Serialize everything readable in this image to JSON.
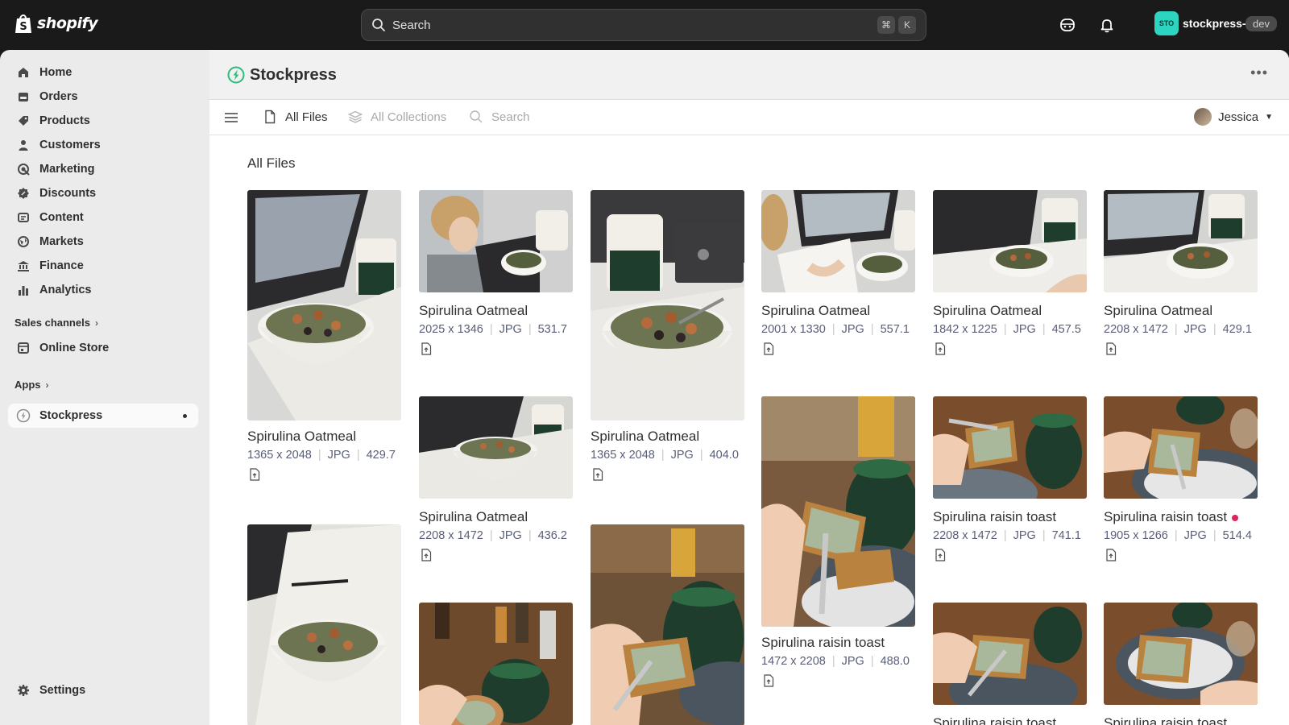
{
  "topbar": {
    "brand": "shopify",
    "search_placeholder": "Search",
    "shortcut_keys": [
      "⌘",
      "K"
    ],
    "store_initials": "STO",
    "store_name": "stockpress-",
    "env_badge": "dev"
  },
  "sidebar": {
    "items": [
      {
        "label": "Home",
        "icon": "home-icon"
      },
      {
        "label": "Orders",
        "icon": "orders-icon"
      },
      {
        "label": "Products",
        "icon": "tag-icon"
      },
      {
        "label": "Customers",
        "icon": "person-icon"
      },
      {
        "label": "Marketing",
        "icon": "target-icon"
      },
      {
        "label": "Discounts",
        "icon": "discount-icon"
      },
      {
        "label": "Content",
        "icon": "content-icon"
      },
      {
        "label": "Markets",
        "icon": "globe-icon"
      },
      {
        "label": "Finance",
        "icon": "bank-icon"
      },
      {
        "label": "Analytics",
        "icon": "bar-chart-icon"
      }
    ],
    "sales_channels_heading": "Sales channels",
    "online_store_label": "Online Store",
    "apps_heading": "Apps",
    "app_item_label": "Stockpress",
    "settings_label": "Settings"
  },
  "app": {
    "title": "Stockpress",
    "more_label": "•••",
    "toolbar": {
      "all_files": "All Files",
      "all_collections": "All Collections",
      "search": "Search",
      "user_name": "Jessica"
    },
    "page_heading": "All Files"
  },
  "files": [
    {
      "title": "Spirulina Oatmeal",
      "dims": "1365 x 2048",
      "type": "JPG",
      "size": "429.7"
    },
    {
      "title": "Spirulina Oatmeal",
      "dims": "2025 x 1346",
      "type": "JPG",
      "size": "531.7"
    },
    {
      "title": "Spirulina Oatmeal",
      "dims": "1365 x 2048",
      "type": "JPG",
      "size": "404.0"
    },
    {
      "title": "Spirulina Oatmeal",
      "dims": "2001 x 1330",
      "type": "JPG",
      "size": "557.1"
    },
    {
      "title": "Spirulina Oatmeal",
      "dims": "1842 x 1225",
      "type": "JPG",
      "size": "457.5"
    },
    {
      "title": "Spirulina Oatmeal",
      "dims": "2208 x 1472",
      "type": "JPG",
      "size": "429.1"
    },
    {
      "title": "Spirulina Oatmeal",
      "dims": "2208 x 1472",
      "type": "JPG",
      "size": "436.2"
    },
    {
      "title": "Spirulina raisin toast",
      "dims": "1472 x 2208",
      "type": "JPG",
      "size": "488.0"
    },
    {
      "title": "Spirulina raisin toast",
      "dims": "2208 x 1472",
      "type": "JPG",
      "size": "741.1"
    },
    {
      "title": "Spirulina raisin toast",
      "dims": "1905 x 1266",
      "type": "JPG",
      "size": "514.4"
    },
    {
      "title": "Spirulina raisin toast"
    },
    {
      "title": "Spirulina raisin toast"
    }
  ],
  "colors": {
    "accent_badge": "#2dd4bf",
    "unread_dot": "#e0245e",
    "meta_text": "#5a5e78"
  }
}
